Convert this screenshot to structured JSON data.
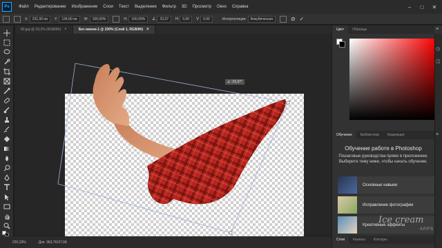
{
  "app": {
    "logo": "Ps"
  },
  "menu": [
    "Файл",
    "Редактирование",
    "Изображение",
    "Слои",
    "Текст",
    "Выделение",
    "Фильтр",
    "3D",
    "Просмотр",
    "Окно",
    "Справка"
  ],
  "window_controls": {
    "minimize": "–",
    "maximize": "□",
    "close": "✕"
  },
  "options": {
    "x_label": "X:",
    "x_value": "231,00 пи",
    "y_label": "Y:",
    "y_value": "134,50 пи",
    "w_label": "W:",
    "w_value": "100,00%",
    "h_label": "H:",
    "h_value": "100,00%",
    "angle_value": "23,37",
    "h_skew": "0,00",
    "v_skew": "0,00",
    "interp_label": "Интерполяция:",
    "interp_value": "Бикубическая",
    "cancel_glyph": "⊘",
    "commit_glyph": "✓"
  },
  "doc_tabs": [
    {
      "label": "80.jpg @ 33,3% (RGB/8#)",
      "close": "×"
    },
    {
      "label": "Без имени-1 @ 200% (Слой 1, RGB/8#)",
      "close": "×"
    }
  ],
  "canvas": {
    "angle_tip": "∠: 23,37°"
  },
  "status": {
    "zoom": "220,33%",
    "doc": "Док: 363,7K/37,6K"
  },
  "color_panel": {
    "tabs": [
      "Цвет",
      "Образцы"
    ]
  },
  "learn_panel": {
    "tabs": [
      "Обучение",
      "Библиотеки",
      "Коррекция"
    ],
    "title": "Обучение работе в Photoshop",
    "description": "Пошаговые руководства прямо в приложении. Выберите тему ниже, чтобы начать обучение.",
    "cards": [
      "Основные навыки",
      "Исправление фотографии",
      "Креативные эффекты"
    ]
  },
  "bottom_tabs": [
    "Слои",
    "Каналы",
    "Контуры"
  ],
  "watermark": {
    "text": "Ice cream",
    "sub": "APPS"
  },
  "colors": {
    "menubar": "#2b2b2b",
    "workspace": "#262626",
    "accent": "#31a8ff",
    "sleeve": "#b5241e"
  }
}
